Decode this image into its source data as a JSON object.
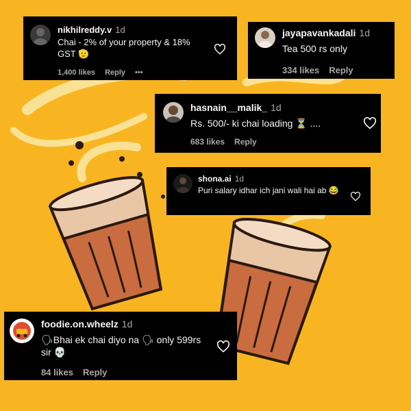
{
  "colors": {
    "background": "#f9b521",
    "card": "#000000",
    "text": "#f5f5f5",
    "muted": "#a8a8a8"
  },
  "comments": [
    {
      "username": "nikhilreddy.v",
      "time": "1d",
      "text": "Chai - 2% of your property & 18% GST 🫡",
      "likes": "1,400 likes",
      "reply": "Reply",
      "more": "•••",
      "avatar_icon": "avatar-icon",
      "like_icon": "heart-outline-icon"
    },
    {
      "username": "jayapavankadali",
      "time": "1d",
      "text": "Tea 500 rs only",
      "likes": "334 likes",
      "reply": "Reply",
      "avatar_icon": "avatar-icon",
      "like_icon": "heart-outline-icon"
    },
    {
      "username": "hasnain__malik_",
      "time": "1d",
      "text": "Rs. 500/- ki chai loading ⏳ ....",
      "likes": "683 likes",
      "reply": "Reply",
      "avatar_icon": "avatar-icon",
      "like_icon": "heart-outline-icon"
    },
    {
      "username": "shona.ai",
      "time": "1d",
      "text": "Puri salary idhar ich jani wali hai ab 😂",
      "avatar_icon": "avatar-icon",
      "like_icon": "heart-outline-icon"
    },
    {
      "username": "foodie.on.wheelz",
      "time": "1d",
      "text": "🗣Bhai ek chai diyo na 🗣 only 599rs sir 💀",
      "likes": "84 likes",
      "reply": "Reply",
      "avatar_icon": "food-logo-avatar-icon",
      "like_icon": "heart-outline-icon"
    }
  ]
}
